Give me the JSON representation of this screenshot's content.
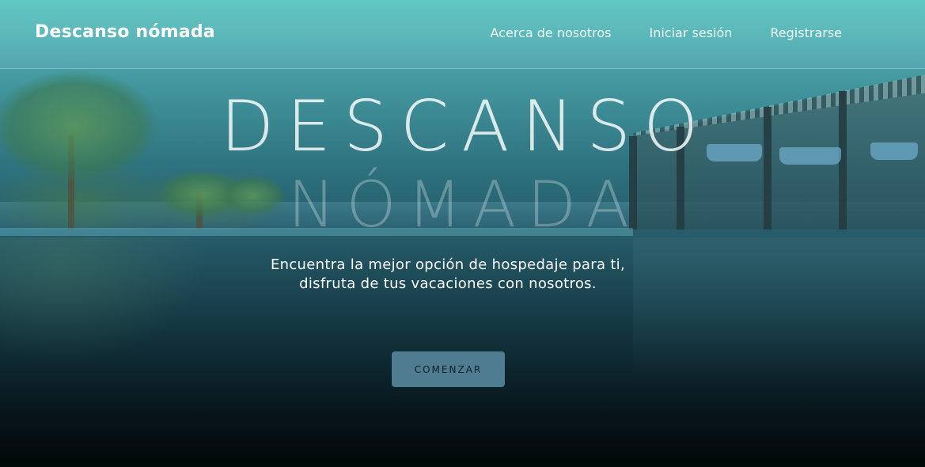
{
  "brand": {
    "name": "Descanso nómada"
  },
  "nav": {
    "items": [
      {
        "label": "Acerca de nosotros"
      },
      {
        "label": "Iniciar sesión"
      },
      {
        "label": "Registrarse"
      }
    ]
  },
  "hero": {
    "title_line1": "DESCANSO",
    "title_line2": "NÓMADA",
    "tagline": "Encuentra la mejor opción de hospedaje para ti, disfruta de tus vacaciones con nosotros.",
    "cta_label": "COMENZAR",
    "background_image": "resort-pool-background"
  },
  "colors": {
    "accent": "#4f7c91",
    "nav_text": "#f2fbfb",
    "brand_text": "#ffffff"
  }
}
